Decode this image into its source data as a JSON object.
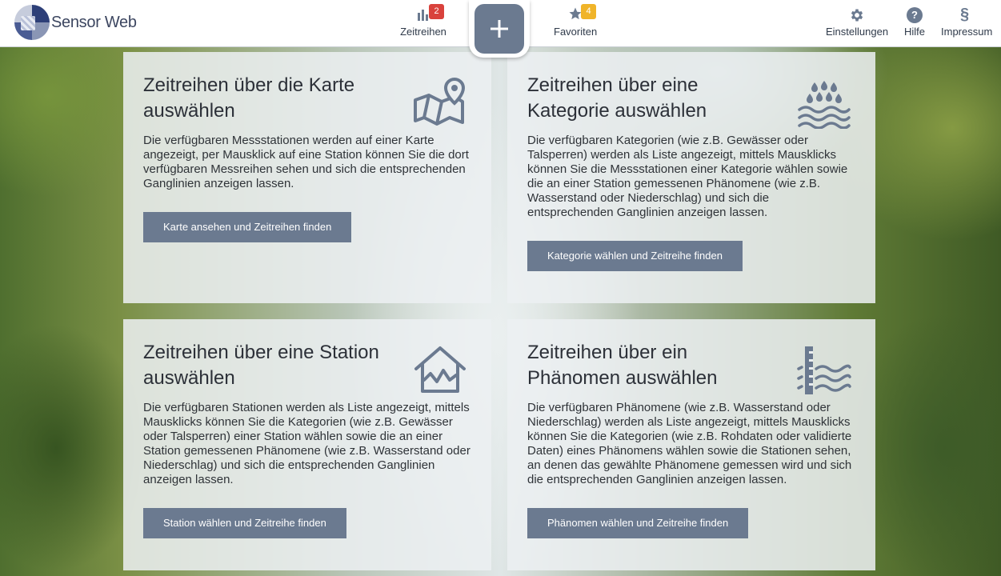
{
  "app": {
    "logo_text": "Sensor Web"
  },
  "nav": {
    "timeseries": {
      "label": "Zeitreihen",
      "badge": "2",
      "icon": "bar-chart-icon",
      "badge_color": "#d9423c"
    },
    "favorites": {
      "label": "Favoriten",
      "badge": "4",
      "icon": "star-icon",
      "badge_color": "#f0b429"
    },
    "add": {
      "icon": "plus-icon"
    },
    "settings": {
      "label": "Einstellungen",
      "icon": "gear-icon"
    },
    "help": {
      "label": "Hilfe",
      "icon": "help-icon"
    },
    "imprint": {
      "label": "Impressum",
      "icon": "section-icon",
      "symbol": "§"
    }
  },
  "cards": [
    {
      "title": "Zeitreihen über die Karte auswählen",
      "text": "Die verfügbaren Messstationen werden auf einer Karte angezeigt, per Mausklick auf eine Station können Sie die dort verfügbaren Messreihen sehen und sich die entsprechenden Ganglinien anzeigen lassen.",
      "button": "Karte ansehen und Zeitreihen finden",
      "icon": "map-marker-icon"
    },
    {
      "title": "Zeitreihen über eine Kategorie auswählen",
      "text": "Die verfügbaren Kategorien (wie z.B. Gewässer oder Talsperren) werden als Liste angezeigt, mittels Mausklicks können Sie die Messstationen einer Kategorie wählen sowie die an einer Station gemessenen Phänomene (wie z.B. Wasserstand oder Niederschlag) und sich die entsprechenden Ganglinien anzeigen lassen.",
      "button": "Kategorie wählen und Zeitreihe finden",
      "icon": "rain-water-icon"
    },
    {
      "title": "Zeitreihen über eine Station auswählen",
      "text": "Die verfügbaren Stationen werden als Liste angezeigt, mittels Mausklicks können Sie die Kategorien (wie z.B. Gewässer oder Talsperren) einer Station wählen sowie die an einer Station gemessenen Phänomene (wie z.B. Wasserstand oder Niederschlag) und sich die entsprechenden Ganglinien anzeigen lassen.",
      "button": "Station wählen und Zeitreihe finden",
      "icon": "station-house-icon"
    },
    {
      "title": "Zeitreihen über ein Phänomen auswählen",
      "text": "Die verfügbaren Phänomene (wie z.B. Wasserstand oder Niederschlag) werden als Liste angezeigt, mittels Mausklicks können Sie die Kategorien (wie z.B. Rohdaten oder validierte Daten) eines Phänomens wählen sowie die Stationen sehen, an denen das gewählte Phänomene gemessen wird und sich die entsprechenden Ganglinien anzeigen lassen.",
      "button": "Phänomen wählen und Zeitreihe finden",
      "icon": "water-gauge-icon"
    }
  ],
  "colors": {
    "accent": "#6b7a90",
    "icon": "#6b7a90"
  }
}
